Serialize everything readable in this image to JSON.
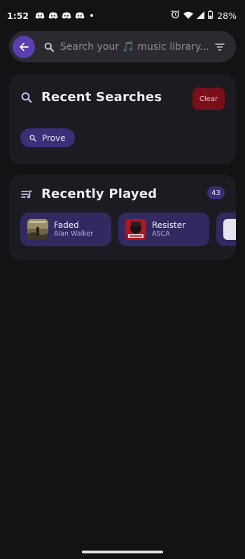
{
  "status_bar": {
    "time": "1:52",
    "battery_percent": "28%",
    "notification_icons": [
      "discord-icon",
      "discord-icon",
      "discord-icon",
      "discord-icon"
    ]
  },
  "search": {
    "placeholder": "Search your 🎵 music library...",
    "value": ""
  },
  "recent_searches": {
    "title": "Recent Searches",
    "clear_label": "Clear",
    "items": [
      {
        "label": "Prove"
      }
    ]
  },
  "recently_played": {
    "title": "Recently Played",
    "count": "43",
    "tracks": [
      {
        "title": "Faded",
        "artist": "Alan Walker"
      },
      {
        "title": "Resister",
        "artist": "ASCA"
      }
    ]
  },
  "colors": {
    "background": "#131316",
    "card": "#1c1b21",
    "accent": "#5a3fb3",
    "chip": "#3b2f78",
    "track_card": "#31295f",
    "clear_button": "#7a0f18"
  }
}
